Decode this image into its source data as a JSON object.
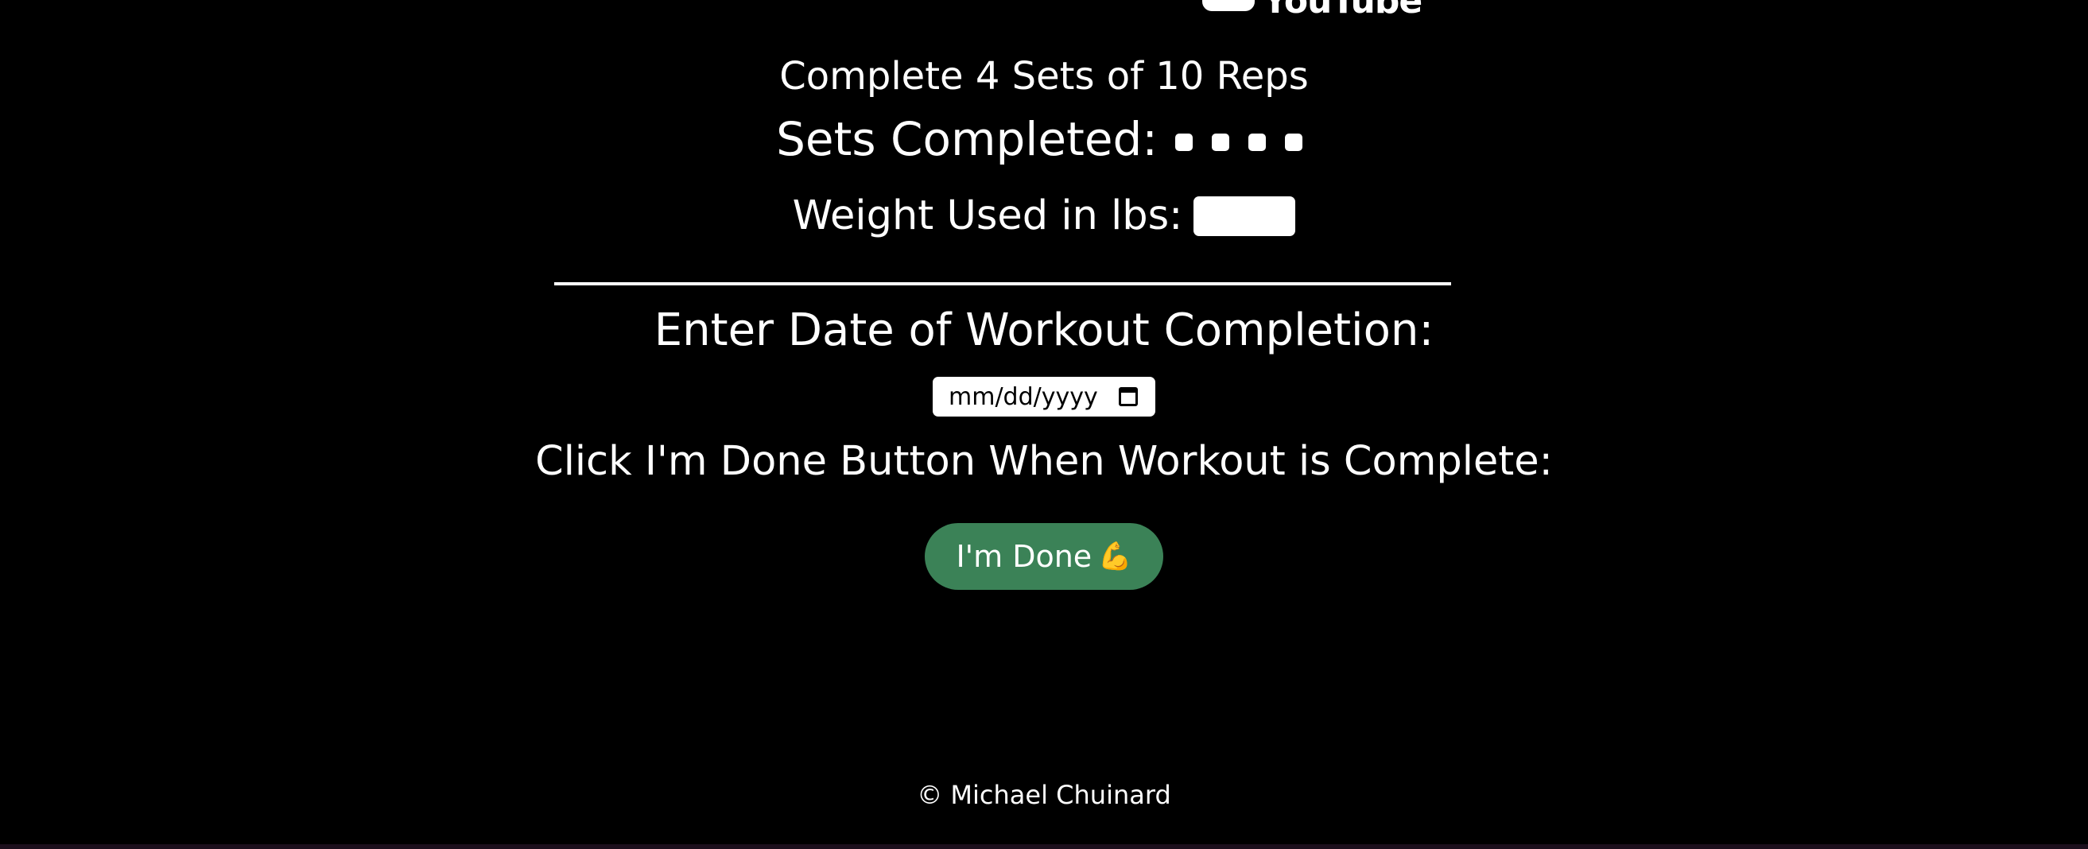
{
  "header": {
    "logo_text": "YouTube"
  },
  "workout": {
    "instructions": "Complete 4 Sets of 10 Reps",
    "sets_label": "Sets Completed:",
    "weight_label": "Weight Used in lbs:",
    "weight_value": ""
  },
  "date": {
    "heading": "Enter Date of Workout Completion:",
    "placeholder": "mm/dd/yyyy"
  },
  "completion": {
    "instruction": "Click I'm Done Button When Workout is Complete:",
    "button_label": "I'm Done",
    "button_icon": "💪"
  },
  "footer": {
    "text": "© Michael Chuinard"
  },
  "colors": {
    "background": "#000000",
    "text": "#ffffff",
    "button": "#3b8257"
  }
}
